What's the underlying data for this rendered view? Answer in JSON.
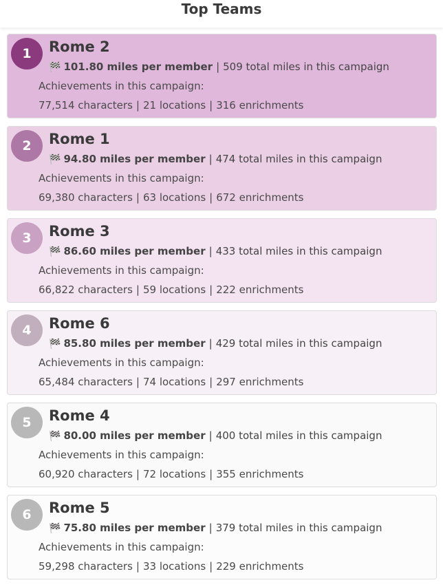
{
  "page": {
    "title": "Top Teams"
  },
  "teams": [
    {
      "rank": "1",
      "name": "Rome 2",
      "per_member": "101.80 miles per member",
      "total": "509 total miles in this campaign",
      "achievements_label": "Achievements in this campaign:",
      "characters": "77,514 characters",
      "locations": "21 locations",
      "enrichments": "316 enrichments",
      "card_bg": "#e0b8db",
      "badge_bg": "#8b3a7e"
    },
    {
      "rank": "2",
      "name": "Rome 1",
      "per_member": "94.80 miles per member",
      "total": "474 total miles in this campaign",
      "achievements_label": "Achievements in this campaign:",
      "characters": "69,380 characters",
      "locations": "63 locations",
      "enrichments": "672 enrichments",
      "card_bg": "#ebd0e5",
      "badge_bg": "#ad78a6"
    },
    {
      "rank": "3",
      "name": "Rome 3",
      "per_member": "86.60 miles per member",
      "total": "433 total miles in this campaign",
      "achievements_label": "Achievements in this campaign:",
      "characters": "66,822 characters",
      "locations": "59 locations",
      "enrichments": "222 enrichments",
      "card_bg": "#f4e3f1",
      "badge_bg": "#c9a2c3"
    },
    {
      "rank": "4",
      "name": "Rome 6",
      "per_member": "85.80 miles per member",
      "total": "429 total miles in this campaign",
      "achievements_label": "Achievements in this campaign:",
      "characters": "65,484 characters",
      "locations": "74 locations",
      "enrichments": "297 enrichments",
      "card_bg": "#f7f0f6",
      "badge_bg": "#c1afbe"
    },
    {
      "rank": "5",
      "name": "Rome 4",
      "per_member": "80.00 miles per member",
      "total": "400 total miles in this campaign",
      "achievements_label": "Achievements in this campaign:",
      "characters": "60,920 characters",
      "locations": "72 locations",
      "enrichments": "355 enrichments",
      "card_bg": "#fbfafb",
      "badge_bg": "#b8b8b8"
    },
    {
      "rank": "6",
      "name": "Rome 5",
      "per_member": "75.80 miles per member",
      "total": "379 total miles in this campaign",
      "achievements_label": "Achievements in this campaign:",
      "characters": "59,298 characters",
      "locations": "33 locations",
      "enrichments": "229 enrichments",
      "card_bg": "#fcfcfc",
      "badge_bg": "#b8b8b8"
    }
  ],
  "icons": {
    "flag": "checkered-flag-icon"
  }
}
